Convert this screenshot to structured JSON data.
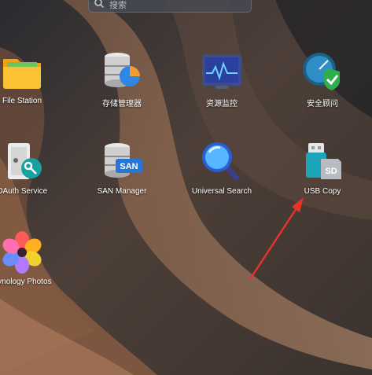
{
  "search": {
    "placeholder": "搜索",
    "icon": "search-icon"
  },
  "apps": [
    {
      "label": "File Station",
      "icon": "folder-icon"
    },
    {
      "label": "存储管理器",
      "icon": "storage-manager-icon"
    },
    {
      "label": "资源监控",
      "icon": "resource-monitor-icon"
    },
    {
      "label": "安全顾问",
      "icon": "security-advisor-icon"
    },
    {
      "label": "OAuth Service",
      "icon": "oauth-key-icon"
    },
    {
      "label": "SAN Manager",
      "icon": "san-manager-icon",
      "badge": "SAN"
    },
    {
      "label": "Universal Search",
      "icon": "magnifier-icon"
    },
    {
      "label": "USB Copy",
      "icon": "usb-copy-icon",
      "badge": "SD"
    },
    {
      "label": "Synology Photos",
      "icon": "photos-flower-icon"
    }
  ],
  "annotation": {
    "icon": "red-arrow-icon",
    "color": "#e8332a"
  }
}
